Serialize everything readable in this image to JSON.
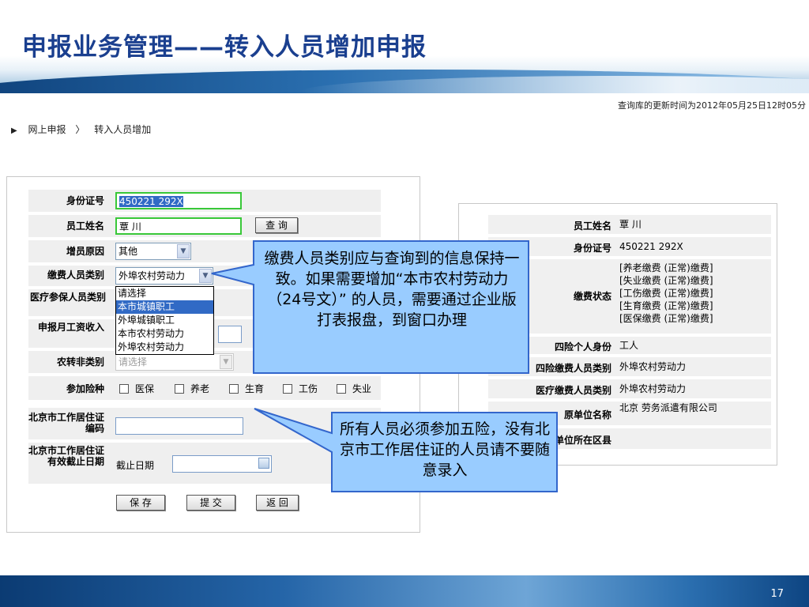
{
  "slide": {
    "title": "申报业务管理——转入人员增加申报",
    "page_number": "17",
    "update_time": "查询库的更新时间为2012年05月25日12时05分"
  },
  "breadcrumb": {
    "items": [
      "网上申报",
      "转入人员增加"
    ],
    "separator": "〉"
  },
  "form": {
    "id_number_label": "身份证号",
    "id_number_value": "450221              292X",
    "name_label": "员工姓名",
    "name_value": "覃  川",
    "query_button": "查  询",
    "reason_label": "增员原因",
    "reason_value": "其他",
    "payer_category_label": "缴费人员类别",
    "payer_category_value": "外埠农村劳动力",
    "payer_category_options": [
      "请选择",
      "本市城镇职工",
      "外埠城镇职工",
      "本市农村劳动力",
      "外埠农村劳动力"
    ],
    "medical_category_label": "医疗参保人员类别",
    "monthly_income_label": "申报月工资收入",
    "agri_label": "农转非类别",
    "agri_placeholder": "请选择",
    "insurance_label": "参加险种",
    "insurance_options": [
      "医保",
      "养老",
      "生育",
      "工伤",
      "失业"
    ],
    "permit_code_label": "北京市工作居住证编码",
    "permit_expiry_label": "北京市工作居住证有效截止日期",
    "expiry_caption": "截止日期",
    "save_button": "保 存",
    "submit_button": "提 交",
    "back_button": "返 回"
  },
  "info_panel": {
    "name_label": "员工姓名",
    "name_value": "覃  川",
    "id_label": "身份证号",
    "id_value": "450221              292X",
    "status_label": "缴费状态",
    "status_values": [
      "[养老缴费 (正常)缴费]",
      "[失业缴费 (正常)缴费]",
      "[工伤缴费 (正常)缴费]",
      "[生育缴费 (正常)缴费]",
      "[医保缴费 (正常)缴费]"
    ],
    "identity_label": "四险个人身份",
    "identity_value": "工人",
    "four_category_label": "四险缴费人员类别",
    "four_category_value": "外埠农村劳动力",
    "medical_category_label": "医疗缴费人员类别",
    "medical_category_value": "外埠农村劳动力",
    "prev_employer_label": "原单位名称",
    "prev_employer_value": "北京                劳务派遣有限公司",
    "district_label": "单位所在区县"
  },
  "callouts": {
    "top": "缴费人员类别应与查询到的信息保持一致。如果需要增加“本市农村劳动力（24号文）” 的人员，需要通过企业版打表报盘，到窗口办理",
    "bottom": "所有人员必须参加五险，没有北京市工作居住证的人员请不要随意录入"
  },
  "colors": {
    "title": "#1a3f8f",
    "callout_fill": "#99ccff",
    "callout_stroke": "#3366cc",
    "highlight": "#316ac5",
    "focus_border": "#39c839"
  }
}
